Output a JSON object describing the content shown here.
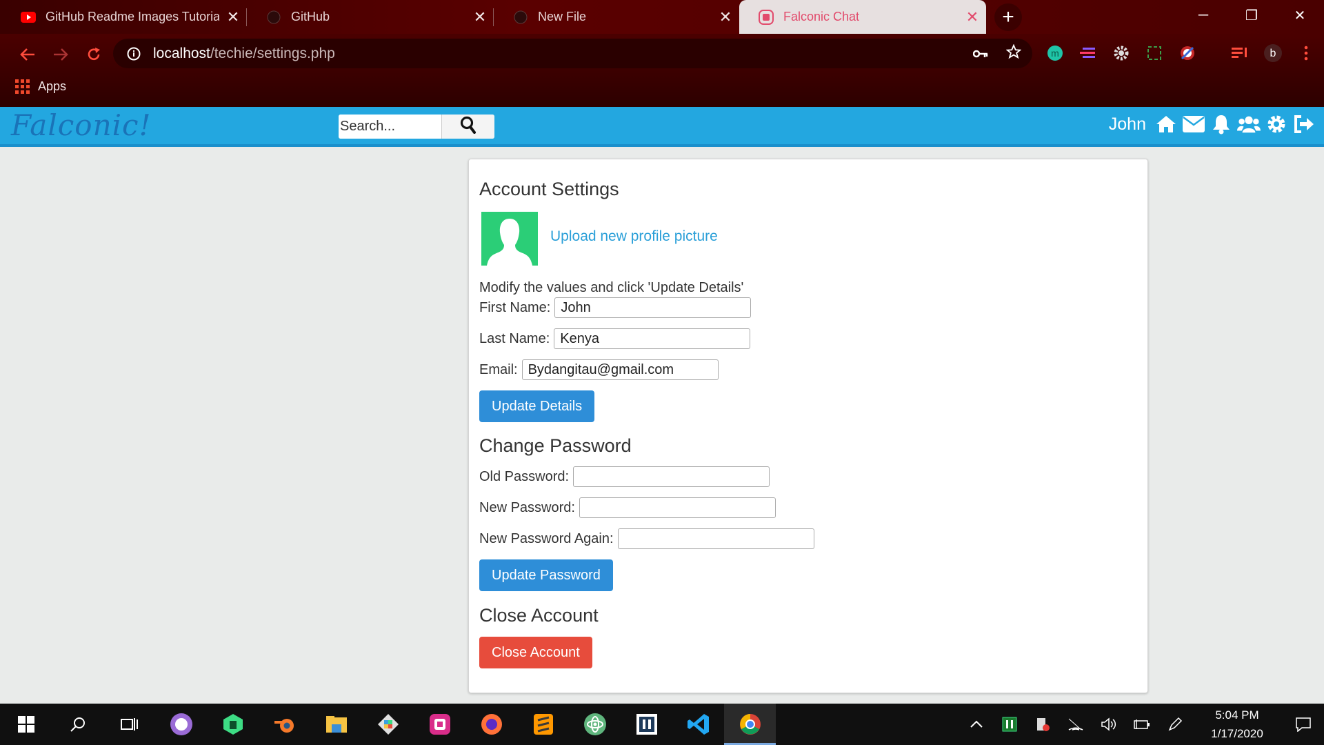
{
  "browser": {
    "tabs": [
      {
        "title": "GitHub Readme Images Tutorial (",
        "icon": "youtube-icon",
        "active": false
      },
      {
        "title": "GitHub",
        "icon": "github-icon",
        "active": false
      },
      {
        "title": "New File",
        "icon": "github-icon",
        "active": false
      },
      {
        "title": "Falconic Chat",
        "icon": "falconic-icon",
        "active": true
      }
    ],
    "url_host": "localhost",
    "url_path": "/techie/settings.php",
    "bookmarks_apps": "Apps",
    "profile_initial": "b"
  },
  "site": {
    "logo": "Falconic!",
    "search_placeholder": "Search...",
    "username": "John",
    "brand_color": "#23a7e0"
  },
  "settings": {
    "account_title": "Account Settings",
    "upload_link": "Upload new profile picture",
    "instructions": "Modify the values and click 'Update Details'",
    "first_name_label": "First Name:",
    "first_name_value": "John",
    "last_name_label": "Last Name:",
    "last_name_value": "Kenya",
    "email_label": "Email:",
    "email_value": "Bydangitau@gmail.com",
    "update_details_btn": "Update Details",
    "password_title": "Change Password",
    "old_password_label": "Old Password:",
    "new_password_label": "New Password:",
    "new_password_again_label": "New Password Again:",
    "update_password_btn": "Update Password",
    "close_title": "Close Account",
    "close_btn": "Close Account"
  },
  "taskbar": {
    "time": "5:04 PM",
    "date": "1/17/2020"
  }
}
